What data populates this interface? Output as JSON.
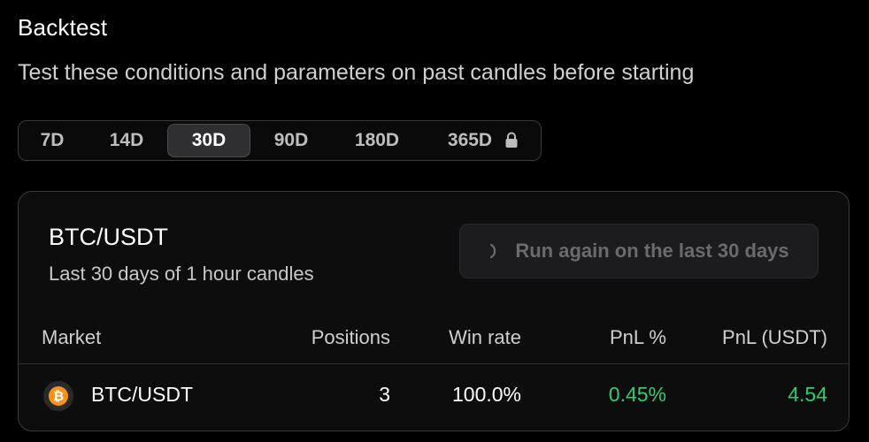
{
  "header": {
    "title": "Backtest",
    "subtitle": "Test these conditions and parameters on past candles before starting"
  },
  "periods": [
    {
      "label": "7D",
      "active": false,
      "locked": false
    },
    {
      "label": "14D",
      "active": false,
      "locked": false
    },
    {
      "label": "30D",
      "active": true,
      "locked": false
    },
    {
      "label": "90D",
      "active": false,
      "locked": false
    },
    {
      "label": "180D",
      "active": false,
      "locked": false
    },
    {
      "label": "365D",
      "active": false,
      "locked": true
    }
  ],
  "card": {
    "pair": "BTC/USDT",
    "description": "Last 30 days of 1 hour candles",
    "run_button": "Run again on the last 30 days"
  },
  "table": {
    "headers": {
      "market": "Market",
      "positions": "Positions",
      "win_rate": "Win rate",
      "pnl_pct": "PnL %",
      "pnl_usdt": "PnL (USDT)"
    },
    "rows": [
      {
        "market": "BTC/USDT",
        "coin_icon": "bitcoin-icon",
        "positions": "3",
        "win_rate": "100.0%",
        "pnl_pct": "0.45%",
        "pnl_usdt": "4.54"
      }
    ]
  },
  "colors": {
    "positive": "#2ecc71",
    "bitcoin": "#f7931a",
    "background": "#000000"
  }
}
